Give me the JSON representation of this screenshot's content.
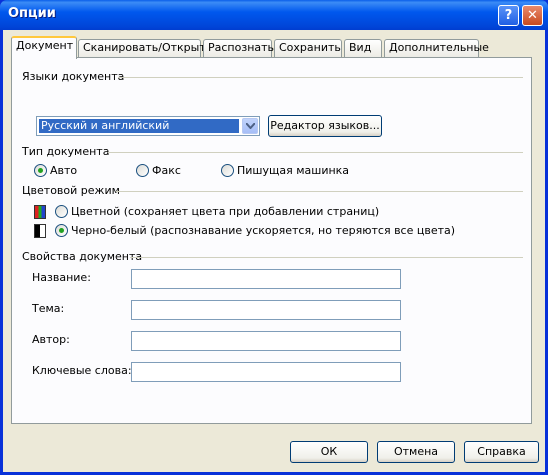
{
  "window": {
    "title": "Опции",
    "help_glyph": "?",
    "close_glyph": "✕"
  },
  "tabs": [
    {
      "label": "Документ"
    },
    {
      "label": "Сканировать/Открыть"
    },
    {
      "label": "Распознать"
    },
    {
      "label": "Сохранить"
    },
    {
      "label": "Вид"
    },
    {
      "label": "Дополнительные"
    }
  ],
  "languages": {
    "group_label": "Языки документа",
    "selected": "Русский и английский",
    "editor_button": "Редактор языков..."
  },
  "doc_type": {
    "group_label": "Тип документа",
    "options": [
      {
        "label": "Авто",
        "checked": true
      },
      {
        "label": "Факс",
        "checked": false
      },
      {
        "label": "Пишущая машинка",
        "checked": false
      }
    ]
  },
  "color_mode": {
    "group_label": "Цветовой режим",
    "options": [
      {
        "label": "Цветной (сохраняет цвета при добавлении страниц)",
        "checked": false
      },
      {
        "label": "Черно-белый (распознавание ускоряется, но теряются все цвета)",
        "checked": true
      }
    ]
  },
  "properties": {
    "group_label": "Свойства документа",
    "fields": [
      {
        "label": "Название:",
        "value": ""
      },
      {
        "label": "Тема:",
        "value": ""
      },
      {
        "label": "Автор:",
        "value": ""
      },
      {
        "label": "Ключевые слова:",
        "value": ""
      }
    ]
  },
  "buttons": {
    "ok": "ОК",
    "cancel": "Отмена",
    "help": "Справка"
  },
  "colors": {
    "titlebar": "#0058ee",
    "client": "#ece9d8",
    "selection": "#316ac5",
    "radio_dot": "#21a121"
  }
}
